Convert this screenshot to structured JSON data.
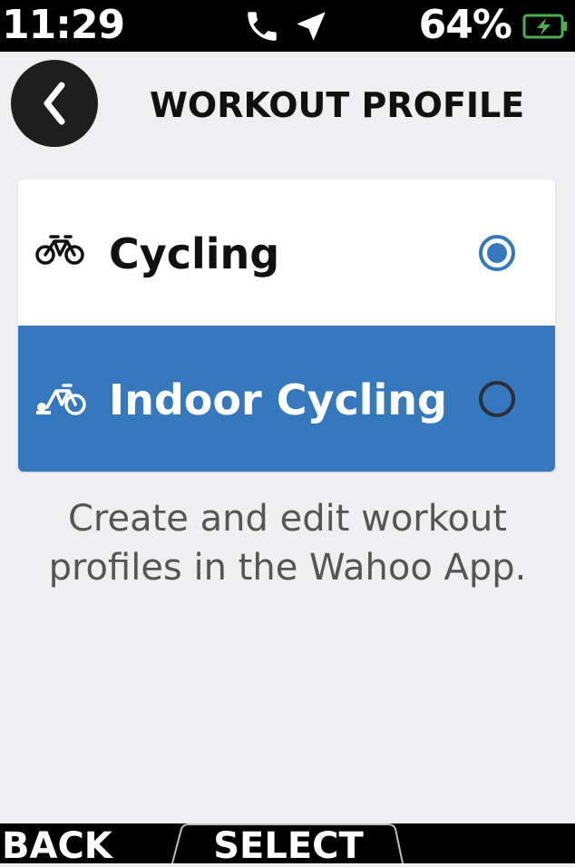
{
  "status_bar": {
    "time": "11:29",
    "battery_percent": "64%",
    "icons": [
      "phone-icon",
      "location-arrow-icon",
      "battery-charging-icon"
    ],
    "battery_color": "#4caf50"
  },
  "header": {
    "title": "WORKOUT PROFILE",
    "back_icon": "chevron-left-icon"
  },
  "profiles": [
    {
      "label": "Cycling",
      "icon": "bicycle-icon",
      "selected": true,
      "highlighted": false
    },
    {
      "label": "Indoor Cycling",
      "icon": "indoor-bicycle-icon",
      "selected": false,
      "highlighted": true
    }
  ],
  "info_text": {
    "line1": "Create and edit workout",
    "line2": "profiles in the Wahoo App."
  },
  "bottom_buttons": {
    "back": "BACK",
    "select": "SELECT"
  },
  "colors": {
    "accent": "#3578be",
    "background": "#efeff1"
  }
}
